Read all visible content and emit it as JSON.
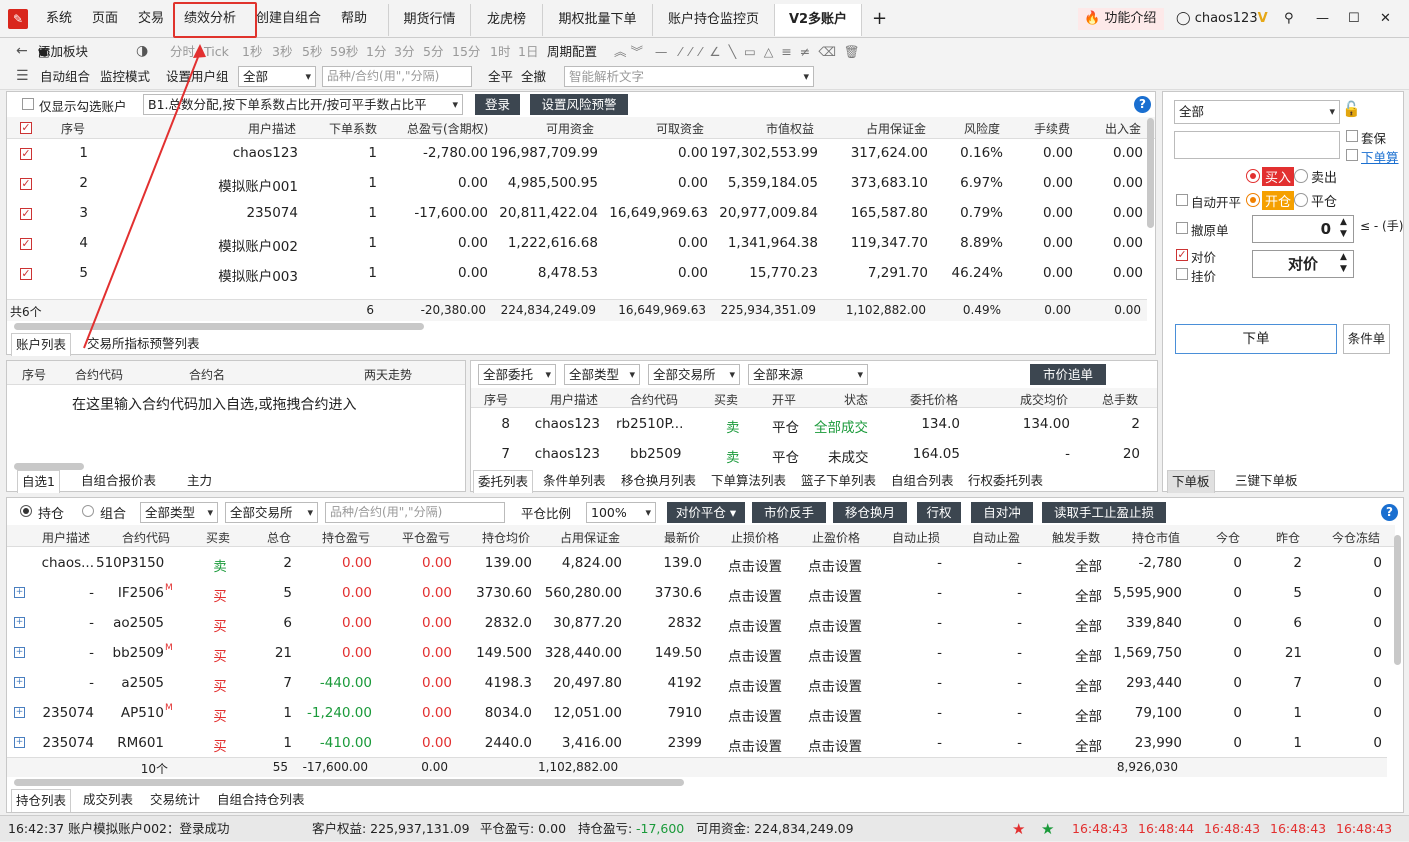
{
  "menu": {
    "items": [
      "系统",
      "页面",
      "交易",
      "绩效分析",
      "创建自组合",
      "帮助"
    ],
    "tabs": [
      "期货行情",
      "龙虎榜",
      "期权批量下单",
      "账户持仓监控页",
      "V2多账户"
    ],
    "add": "+",
    "feature": "功能介绍",
    "user": "chaos123",
    "vip": "V"
  },
  "toolbar1": {
    "add_block": "添加板块",
    "periods": [
      "分时",
      "Tick",
      "1秒",
      "3秒",
      "5秒",
      "59秒",
      "1分",
      "3分",
      "5分",
      "15分",
      "1时",
      "1日",
      "周期配置"
    ]
  },
  "toolbar2": {
    "auto_combo": "自动组合",
    "monitor": "监控模式",
    "set_group": "设置用户组",
    "group_value": "全部",
    "contract_placeholder": "品种/合约(用\",\"分隔)",
    "close_all": "全平",
    "cancel_all": "全撤",
    "smart_placeholder": "智能解析文字"
  },
  "accounts": {
    "only_checked": "仅显示勾选账户",
    "strategy": "B1.总数分配,按下单系数占比开/按可平手数占比平",
    "login": "登录",
    "risk": "设置风险预警",
    "headers": [
      "序号",
      "用户描述",
      "下单系数",
      "总盈亏(含期权)",
      "可用资金",
      "可取资金",
      "市值权益",
      "占用保证金",
      "风险度",
      "手续费",
      "出入金"
    ],
    "rows": [
      [
        "1",
        "chaos123",
        "1",
        "-2,780.00",
        "196,987,709.99",
        "0.00",
        "197,302,553.99",
        "317,624.00",
        "0.16%",
        "0.00",
        "0.00"
      ],
      [
        "2",
        "模拟账户001",
        "1",
        "0.00",
        "4,985,500.95",
        "0.00",
        "5,359,184.05",
        "373,683.10",
        "6.97%",
        "0.00",
        "0.00"
      ],
      [
        "3",
        "235074",
        "1",
        "-17,600.00",
        "20,811,422.04",
        "16,649,969.63",
        "20,977,009.84",
        "165,587.80",
        "0.79%",
        "0.00",
        "0.00"
      ],
      [
        "4",
        "模拟账户002",
        "1",
        "0.00",
        "1,222,616.68",
        "0.00",
        "1,341,964.38",
        "119,347.70",
        "8.89%",
        "0.00",
        "0.00"
      ],
      [
        "5",
        "模拟账户003",
        "1",
        "0.00",
        "8,478.53",
        "0.00",
        "15,770.23",
        "7,291.70",
        "46.24%",
        "0.00",
        "0.00"
      ]
    ],
    "total": [
      "共6个",
      "6",
      "-20,380.00",
      "224,834,249.09",
      "16,649,969.63",
      "225,934,351.09",
      "1,102,882.00",
      "0.49%",
      "0.00",
      "0.00"
    ],
    "tabs": [
      "账户列表",
      "交易所指标预警列表"
    ]
  },
  "watch": {
    "headers": [
      "序号",
      "合约代码",
      "合约名",
      "两天走势"
    ],
    "hint": "在这里输入合约代码加入自选,或拖拽合约进入",
    "tabs": [
      "自选1",
      "自组合报价表",
      "主力"
    ]
  },
  "orders": {
    "filters": [
      "全部委托",
      "全部类型",
      "全部交易所",
      "全部来源"
    ],
    "chase": "市价追单",
    "headers": [
      "序号",
      "用户描述",
      "合约代码",
      "买卖",
      "开平",
      "状态",
      "委托价格",
      "成交均价",
      "总手数"
    ],
    "rows": [
      [
        "8",
        "chaos123",
        "rb2510P...",
        "卖",
        "平仓",
        "全部成交",
        "134.0",
        "134.00",
        "2"
      ],
      [
        "7",
        "chaos123",
        "bb2509",
        "卖",
        "平仓",
        "未成交",
        "164.05",
        "-",
        "20"
      ]
    ],
    "tabs": [
      "委托列表",
      "条件单列表",
      "移仓换月列表",
      "下单算法列表",
      "篮子下单列表",
      "自组合列表",
      "行权委托列表"
    ]
  },
  "order_panel": {
    "account": "全部",
    "hedge": "套保",
    "order_calc": "下单算",
    "buy": "买入",
    "sell": "卖出",
    "auto_open_close": "自动开平",
    "open": "开仓",
    "close": "平仓",
    "cancel_origin": "撤原单",
    "qty": "0",
    "qty_note": "≤ - (手)",
    "counter_price": "对价",
    "pending_price": "挂价",
    "price_type": "对价",
    "submit": "下单",
    "cond_order": "条件单",
    "tabs": [
      "下单板",
      "三键下单板"
    ]
  },
  "positions": {
    "hold": "持仓",
    "combo": "组合",
    "type": "全部类型",
    "exchange": "全部交易所",
    "placeholder": "品种/合约(用\",\"分隔)",
    "ratio_label": "平仓比例",
    "ratio": "100%",
    "actions": [
      "对价平仓",
      "市价反手",
      "移仓换月",
      "行权",
      "自对冲",
      "读取手工止盈止损"
    ],
    "headers": [
      "用户描述",
      "合约代码",
      "买卖",
      "总仓",
      "持仓盈亏",
      "平仓盈亏",
      "持仓均价",
      "占用保证金",
      "最新价",
      "止损价格",
      "止盈价格",
      "自动止损",
      "自动止盈",
      "触发手数",
      "持仓市值",
      "今仓",
      "昨仓",
      "今仓冻结"
    ],
    "rows": [
      [
        "chaos...",
        "510P3150",
        "",
        "卖",
        "2",
        "0.00",
        "0.00",
        "139.00",
        "4,824.00",
        "139.0",
        "点击设置",
        "点击设置",
        "-",
        "-",
        "全部",
        "-2,780",
        "0",
        "2",
        "0"
      ],
      [
        "-",
        "IF2506",
        "M",
        "买",
        "5",
        "0.00",
        "0.00",
        "3730.60",
        "560,280.00",
        "3730.6",
        "点击设置",
        "点击设置",
        "-",
        "-",
        "全部",
        "5,595,900",
        "0",
        "5",
        "0"
      ],
      [
        "-",
        "ao2505",
        "",
        "买",
        "6",
        "0.00",
        "0.00",
        "2832.0",
        "30,877.20",
        "2832",
        "点击设置",
        "点击设置",
        "-",
        "-",
        "全部",
        "339,840",
        "0",
        "6",
        "0"
      ],
      [
        "-",
        "bb2509",
        "M",
        "买",
        "21",
        "0.00",
        "0.00",
        "149.500",
        "328,440.00",
        "149.50",
        "点击设置",
        "点击设置",
        "-",
        "-",
        "全部",
        "1,569,750",
        "0",
        "21",
        "0"
      ],
      [
        "-",
        "a2505",
        "",
        "买",
        "7",
        "-440.00",
        "0.00",
        "4198.3",
        "20,497.80",
        "4192",
        "点击设置",
        "点击设置",
        "-",
        "-",
        "全部",
        "293,440",
        "0",
        "7",
        "0"
      ],
      [
        "235074",
        "AP510",
        "M",
        "买",
        "1",
        "-1,240.00",
        "0.00",
        "8034.0",
        "12,051.00",
        "7910",
        "点击设置",
        "点击设置",
        "-",
        "-",
        "全部",
        "79,100",
        "0",
        "1",
        "0"
      ],
      [
        "235074",
        "RM601",
        "",
        "买",
        "1",
        "-410.00",
        "0.00",
        "2440.0",
        "3,416.00",
        "2399",
        "点击设置",
        "点击设置",
        "-",
        "-",
        "全部",
        "23,990",
        "0",
        "1",
        "0"
      ]
    ],
    "total": [
      "10个",
      "55",
      "-17,600.00",
      "0.00",
      "1,102,882.00",
      "8,926,030"
    ],
    "tabs": [
      "持仓列表",
      "成交列表",
      "交易统计",
      "自组合持仓列表"
    ]
  },
  "status": {
    "msg": "16:42:37 账户模拟账户002：登录成功",
    "equity": "客户权益: 225,937,131.09",
    "close_pl": "平仓盈亏: 0.00",
    "hold_pl_label": "持仓盈亏:",
    "hold_pl": "-17,600",
    "avail": "可用资金: 224,834,249.09",
    "times": [
      "16:48:43",
      "16:48:44",
      "16:48:43",
      "16:48:43",
      "16:48:43"
    ]
  },
  "colors": {
    "accent": "#e23030",
    "green": "#1a9a3a",
    "dark_button": "#3c4650"
  }
}
